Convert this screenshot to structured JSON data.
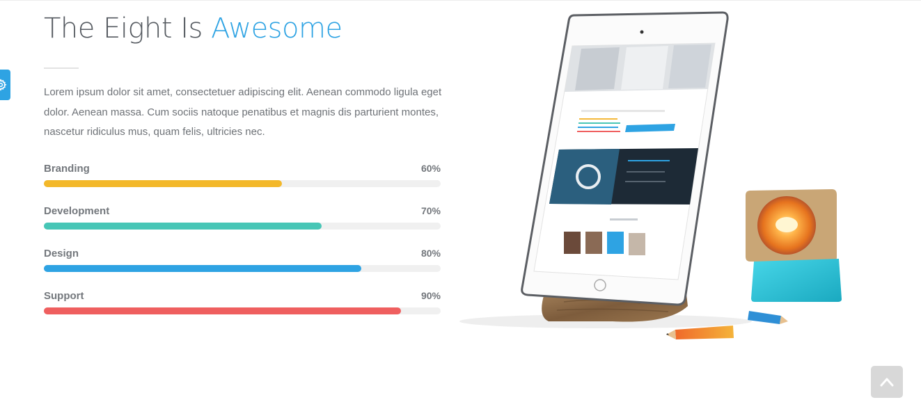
{
  "header": {
    "title_main": "The Eight Is ",
    "title_accent": "Awesome"
  },
  "intro": {
    "text": "Lorem ipsum dolor sit amet, consectetuer adipiscing elit. Aenean commodo ligula eget dolor. Aenean massa. Cum sociis natoque penatibus et magnis dis parturient montes, nascetur ridiculus mus, quam felis, ultricies nec."
  },
  "skills": [
    {
      "label": "Branding",
      "percent_label": "60%",
      "value": 60,
      "color": "#f3b82a"
    },
    {
      "label": "Development",
      "percent_label": "70%",
      "value": 70,
      "color": "#47c6b6"
    },
    {
      "label": "Design",
      "percent_label": "80%",
      "value": 80,
      "color": "#2ea3e3"
    },
    {
      "label": "Support",
      "percent_label": "90%",
      "value": 90,
      "color": "#ef5f5f"
    }
  ],
  "colors": {
    "accent": "#2ea3e3",
    "text": "#6e7277",
    "track": "#f0f0f0",
    "back_to_top_bg": "#d8d8d8"
  },
  "icons": {
    "settings": "gear-icon",
    "back_to_top": "chevron-up-icon"
  }
}
